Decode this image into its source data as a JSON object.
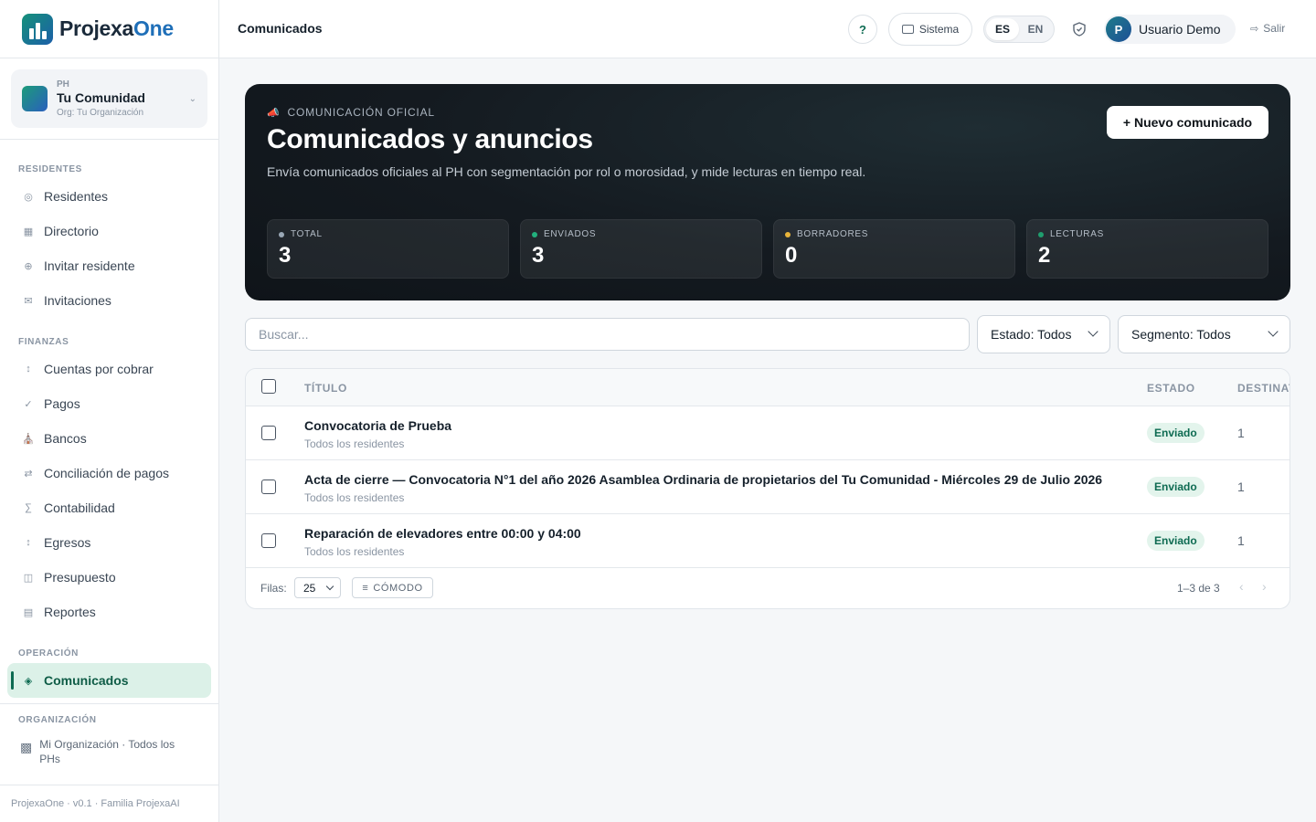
{
  "brand": {
    "name_part1": "Projexa",
    "name_part2": "One"
  },
  "org_card": {
    "kicker": "PH",
    "name": "Tu Comunidad",
    "sub": "Org: Tu Organización"
  },
  "nav": {
    "section_residentes": "RESIDENTES",
    "residentes": "Residentes",
    "directorio": "Directorio",
    "invitar": "Invitar residente",
    "invitaciones": "Invitaciones",
    "section_finanzas": "FINANZAS",
    "cuentas": "Cuentas por cobrar",
    "pagos": "Pagos",
    "bancos": "Bancos",
    "conciliacion": "Conciliación de pagos",
    "contabilidad": "Contabilidad",
    "egresos": "Egresos",
    "presupuesto": "Presupuesto",
    "reportes": "Reportes",
    "section_operacion": "OPERACIÓN",
    "comunicados": "Comunicados"
  },
  "org_footer": {
    "section": "ORGANIZACIÓN",
    "item": "Mi Organización · Todos los PHs"
  },
  "sidebar_footer": "ProjexaOne · v0.1 · Familia ProjexaAI",
  "topbar": {
    "title": "Comunicados",
    "help": "?",
    "system": "Sistema",
    "lang_es": "ES",
    "lang_en": "EN",
    "user_initial": "P",
    "user_name": "Usuario Demo",
    "logout": "Salir"
  },
  "hero": {
    "kicker": "COMUNICACIÓN OFICIAL",
    "title": "Comunicados y anuncios",
    "description": "Envía comunicados oficiales al PH con segmentación por rol o morosidad, y mide lecturas en tiempo real.",
    "new_button": "+ Nuevo comunicado",
    "stats": [
      {
        "label": "TOTAL",
        "value": "3",
        "color": "#9aa8b6"
      },
      {
        "label": "ENVIADOS",
        "value": "3",
        "color": "#22b07d"
      },
      {
        "label": "BORRADORES",
        "value": "0",
        "color": "#e8b43a"
      },
      {
        "label": "LECTURAS",
        "value": "2",
        "color": "#1f9e6e"
      }
    ]
  },
  "filters": {
    "search_placeholder": "Buscar...",
    "estado": "Estado: Todos",
    "segmento": "Segmento: Todos"
  },
  "table": {
    "headers": {
      "title": "TÍTULO",
      "status": "ESTADO",
      "recipients": "DESTINAT"
    },
    "rows": [
      {
        "title": "Convocatoria de Prueba",
        "segment": "Todos los residentes",
        "status": "Enviado",
        "recipients": "1"
      },
      {
        "title": "Acta de cierre — Convocatoria N°1 del año 2026 Asamblea Ordinaria de propietarios del Tu Comunidad - Miércoles 29 de Julio 2026",
        "segment": "Todos los residentes",
        "status": "Enviado",
        "recipients": "1"
      },
      {
        "title": "Reparación de elevadores entre 00:00 y 04:00",
        "segment": "Todos los residentes",
        "status": "Enviado",
        "recipients": "1"
      }
    ],
    "footer": {
      "rows_label": "Filas:",
      "rows_value": "25",
      "density": "CÓMODO",
      "range": "1–3 de 3",
      "prev": "‹",
      "next": "›"
    }
  }
}
